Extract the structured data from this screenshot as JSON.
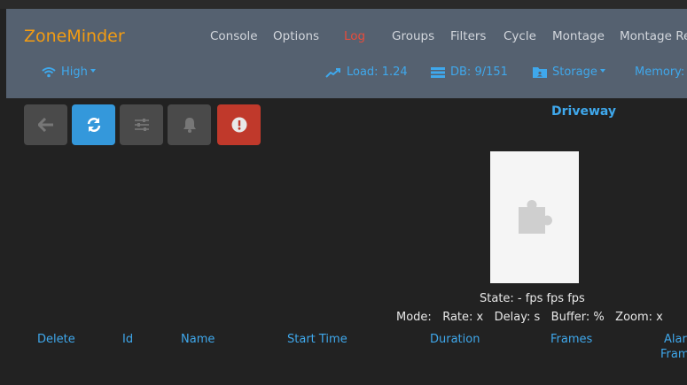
{
  "app": {
    "brand": "ZoneMinder"
  },
  "menu": [
    {
      "label": "Console",
      "active": false
    },
    {
      "label": "Options",
      "active": false
    },
    {
      "label": "Log",
      "active": true
    },
    {
      "label": "Groups",
      "active": false
    },
    {
      "label": "Filters",
      "active": false
    },
    {
      "label": "Cycle",
      "active": false
    },
    {
      "label": "Montage",
      "active": false
    },
    {
      "label": "Montage Re",
      "active": false
    }
  ],
  "status": {
    "bandwidth": "High",
    "load": "Load: 1.24",
    "db": "DB: 9/151",
    "storage": "Storage",
    "memory": "Memory:"
  },
  "toolbar": {
    "buttons": [
      {
        "name": "back",
        "icon": "arrow-left-icon"
      },
      {
        "name": "refresh",
        "icon": "refresh-icon"
      },
      {
        "name": "settings",
        "icon": "sliders-icon"
      },
      {
        "name": "alarm",
        "icon": "bell-icon"
      },
      {
        "name": "force-alarm",
        "icon": "exclamation-circle-icon"
      }
    ]
  },
  "monitor": {
    "name": "Driveway",
    "state": "State: - fps fps fps",
    "mode": "Mode:",
    "rate": "Rate: x",
    "delay": "Delay: s",
    "buffer": "Buffer: %",
    "zoom": "Zoom: x",
    "placeholder_icon": "puzzle-piece-icon"
  },
  "events_table": {
    "columns": [
      "Delete",
      "Id",
      "Name",
      "Start Time",
      "Duration",
      "Frames"
    ],
    "alarm_frames": [
      "Alar",
      "Fram"
    ]
  },
  "colors": {
    "navbar": "#556170",
    "brand": "#f39c12",
    "accent": "#3fa8ec",
    "active_menu": "#e74c3c",
    "background": "#222222"
  }
}
